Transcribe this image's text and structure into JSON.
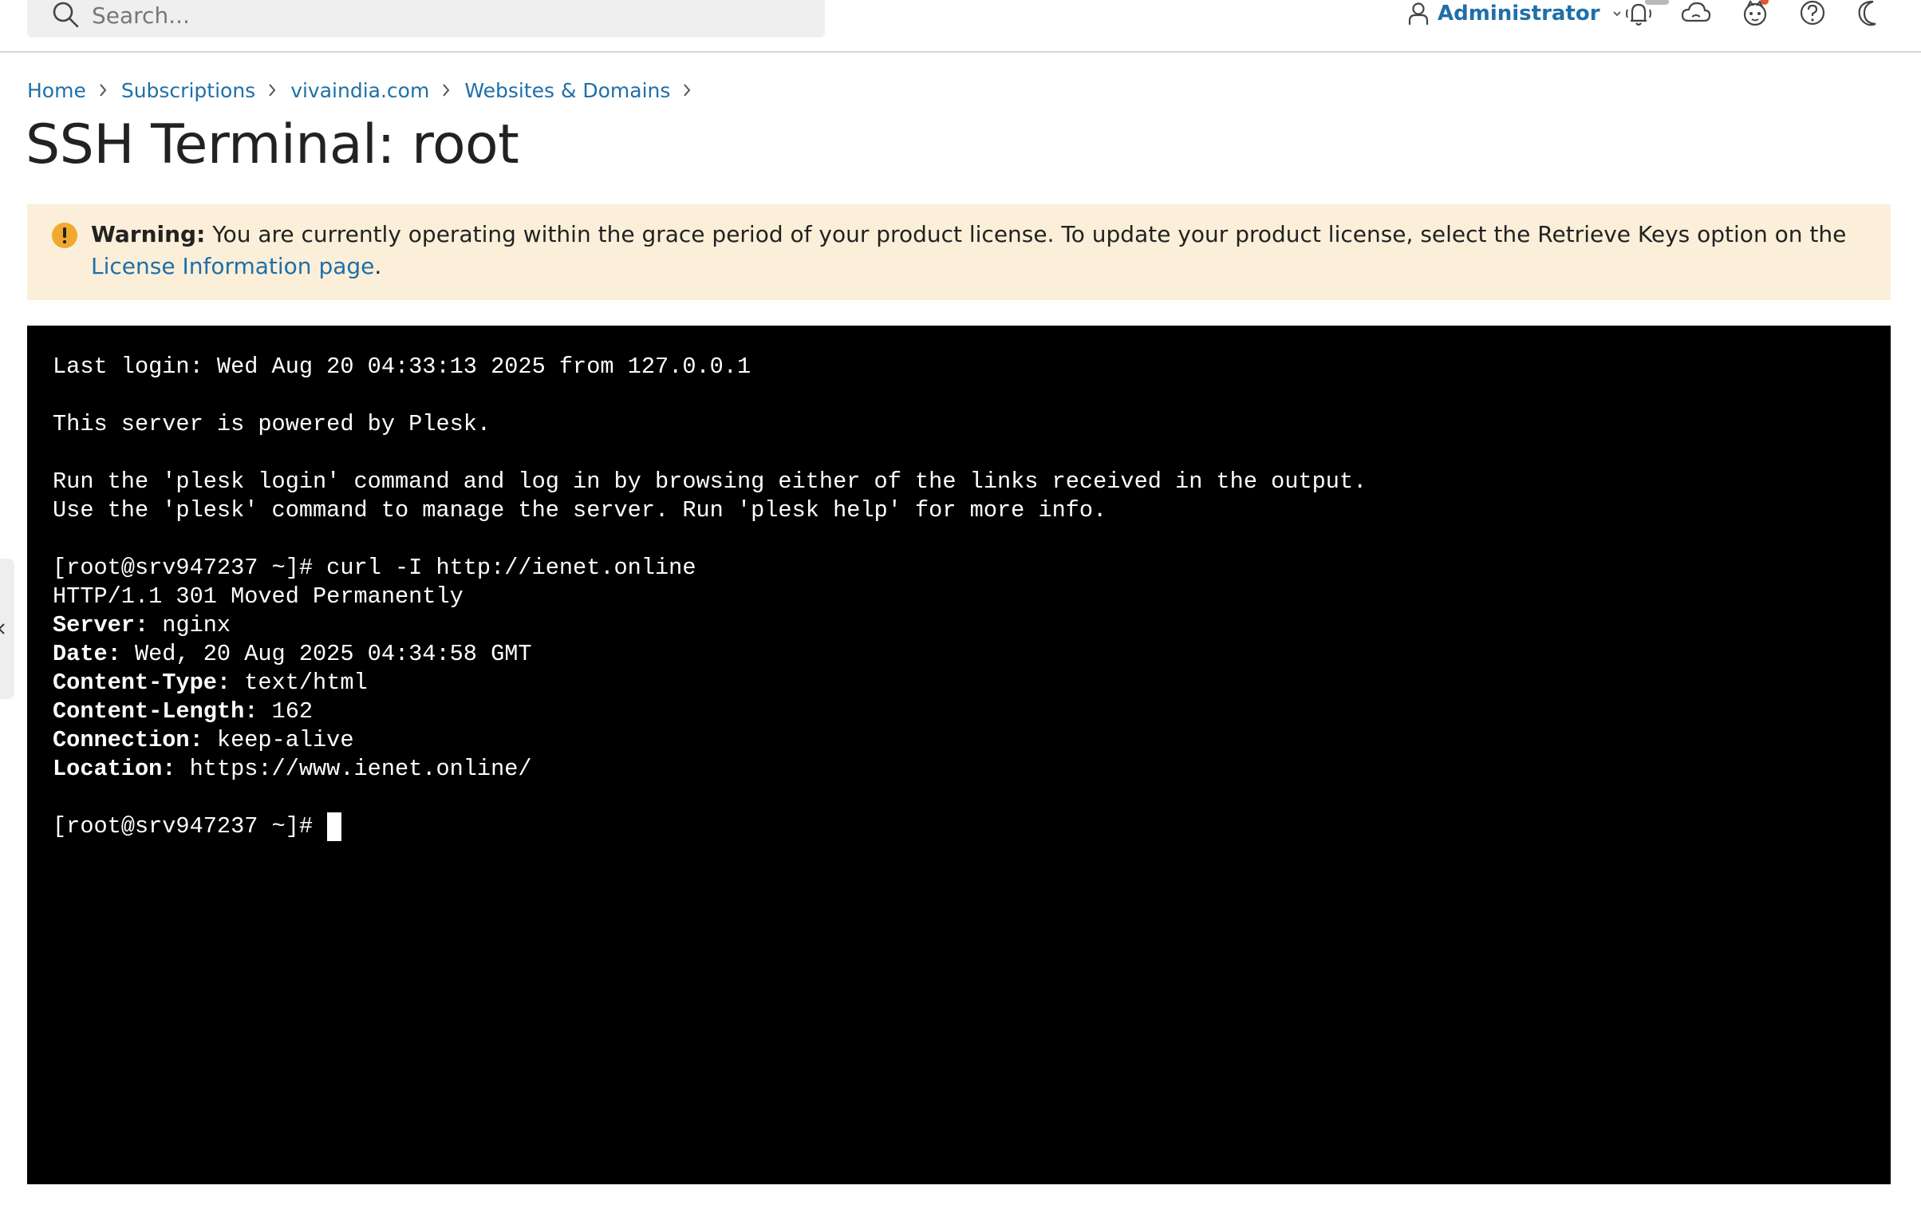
{
  "topbar": {
    "search_placeholder": "Search...",
    "user_label": "Administrator",
    "icons": [
      "notifications-icon",
      "cloud-icon",
      "extensions-icon",
      "help-icon",
      "dark-mode-icon"
    ]
  },
  "breadcrumb": {
    "items": [
      "Home",
      "Subscriptions",
      "vivaindia.com",
      "Websites & Domains"
    ]
  },
  "page": {
    "title": "SSH Terminal: root"
  },
  "warning": {
    "label": "Warning:",
    "message": " You are currently operating within the grace period of your product license. To update your product license, select the Retrieve Keys option on the ",
    "link_text": "License Information page",
    "suffix": "."
  },
  "terminal": {
    "lines": [
      "Last login: Wed Aug 20 04:33:13 2025 from 127.0.0.1",
      "",
      "This server is powered by Plesk.",
      "",
      "Run the 'plesk login' command and log in by browsing either of the links received in the output.",
      "Use the 'plesk' command to manage the server. Run 'plesk help' for more info.",
      "",
      "[root@srv947237 ~]# curl -I http://ienet.online",
      "HTTP/1.1 301 Moved Permanently"
    ],
    "headers": [
      {
        "name": "Server:",
        "value": " nginx"
      },
      {
        "name": "Date:",
        "value": " Wed, 20 Aug 2025 04:34:58 GMT"
      },
      {
        "name": "Content-Type:",
        "value": " text/html"
      },
      {
        "name": "Content-Length:",
        "value": " 162"
      },
      {
        "name": "Connection:",
        "value": " keep-alive"
      },
      {
        "name": "Location:",
        "value": " https://www.ienet.online/"
      }
    ],
    "prompt": "[root@srv947237 ~]# "
  },
  "colors": {
    "link": "#1f6fa8",
    "warning_bg": "#fbefd9",
    "warning_icon": "#f0a92e",
    "terminal_bg": "#000000",
    "terminal_fg": "#ffffff"
  }
}
